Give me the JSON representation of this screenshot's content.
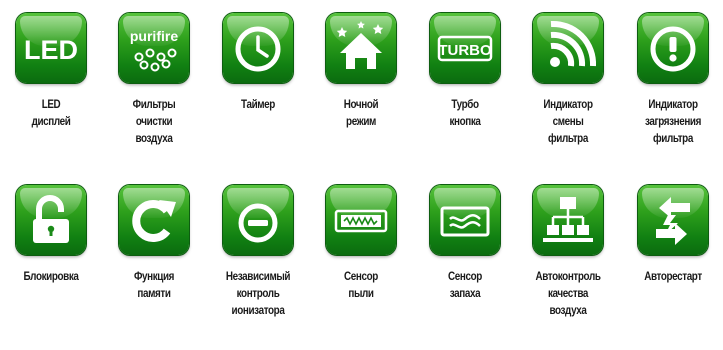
{
  "features": [
    {
      "icon": "led-icon",
      "icon_text": "LED",
      "caption": [
        "LED",
        "дисплей"
      ]
    },
    {
      "icon": "air-purifier-filter-icon",
      "icon_text": "purifire",
      "caption": [
        "Фильтры",
        "очистки",
        "воздуха"
      ]
    },
    {
      "icon": "timer-clock-icon",
      "caption": [
        "Таймер"
      ]
    },
    {
      "icon": "night-mode-house-icon",
      "caption": [
        "Ночной",
        "режим"
      ]
    },
    {
      "icon": "turbo-icon",
      "icon_text": "TURBO",
      "caption": [
        "Турбо",
        "кнопка"
      ]
    },
    {
      "icon": "filter-change-indicator-icon",
      "caption": [
        "Индикатор",
        "смены",
        "фильтра"
      ]
    },
    {
      "icon": "filter-contamination-warning-icon",
      "caption": [
        "Индикатор",
        "загрязнения",
        "фильтра"
      ]
    },
    {
      "icon": "lock-icon",
      "caption": [
        "Блокировка"
      ]
    },
    {
      "icon": "memory-function-icon",
      "caption": [
        "Функция",
        "памяти"
      ]
    },
    {
      "icon": "ionizer-control-icon",
      "caption": [
        "Независимый",
        "контроль",
        "ионизатора"
      ]
    },
    {
      "icon": "dust-sensor-icon",
      "caption": [
        "Сенсор",
        "пыли"
      ]
    },
    {
      "icon": "odor-sensor-icon",
      "caption": [
        "Сенсор",
        "запаха"
      ]
    },
    {
      "icon": "air-quality-autocontrol-icon",
      "caption": [
        "Автоконтроль",
        "качества",
        "воздуха"
      ]
    },
    {
      "icon": "auto-restart-icon",
      "caption": [
        "Авторестарт"
      ]
    }
  ]
}
